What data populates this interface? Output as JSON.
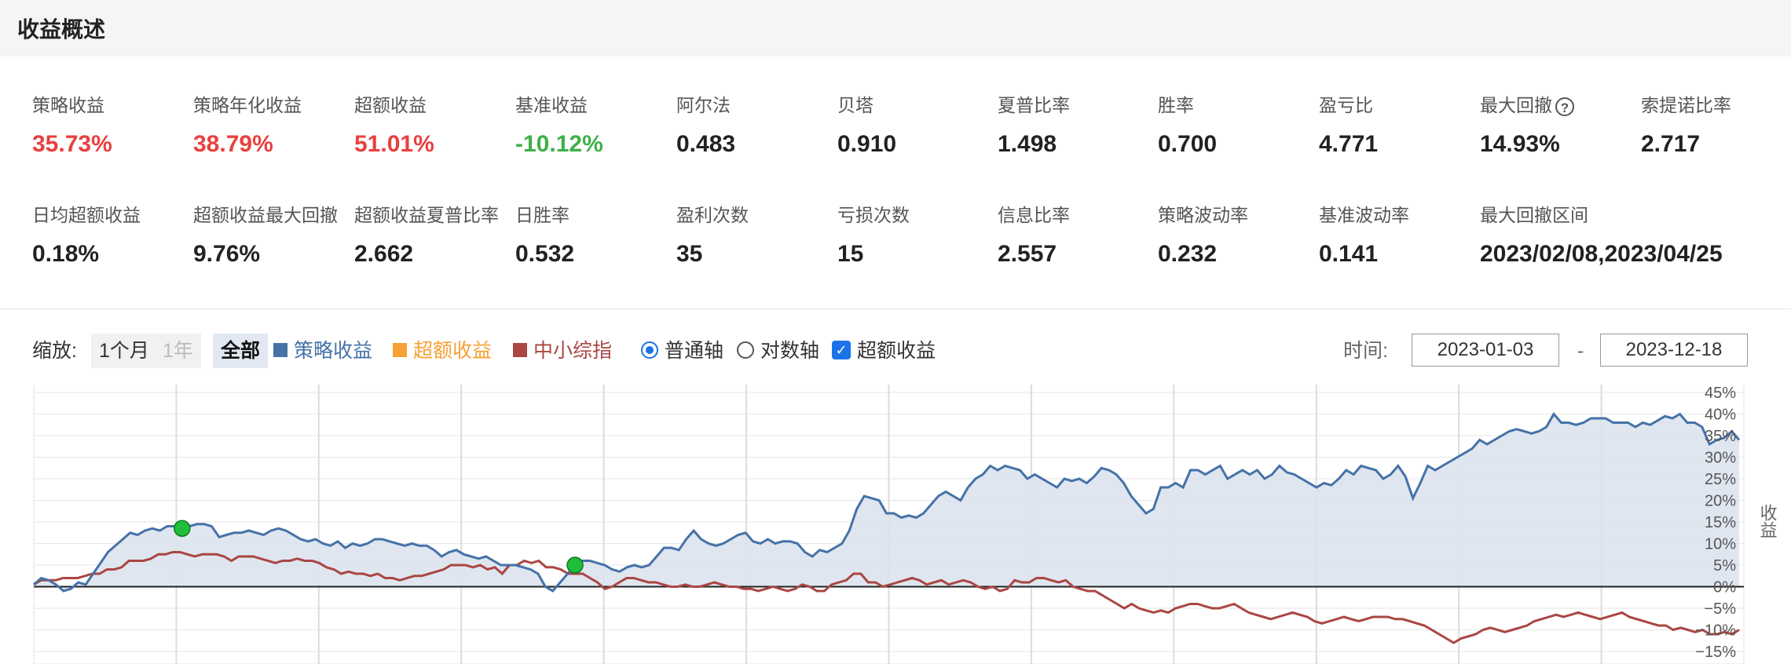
{
  "header": {
    "title": "收益概述"
  },
  "metrics_row1": [
    {
      "label": "策略收益",
      "value": "35.73%",
      "tone": "pos"
    },
    {
      "label": "策略年化收益",
      "value": "38.79%",
      "tone": "pos"
    },
    {
      "label": "超额收益",
      "value": "51.01%",
      "tone": "pos"
    },
    {
      "label": "基准收益",
      "value": "-10.12%",
      "tone": "neg"
    },
    {
      "label": "阿尔法",
      "value": "0.483",
      "tone": ""
    },
    {
      "label": "贝塔",
      "value": "0.910",
      "tone": ""
    },
    {
      "label": "夏普比率",
      "value": "1.498",
      "tone": ""
    },
    {
      "label": "胜率",
      "value": "0.700",
      "tone": ""
    },
    {
      "label": "盈亏比",
      "value": "4.771",
      "tone": ""
    },
    {
      "label": "最大回撤",
      "value": "14.93%",
      "tone": "",
      "help": "?"
    },
    {
      "label": "索提诺比率",
      "value": "2.717",
      "tone": ""
    }
  ],
  "metrics_row2": [
    {
      "label": "日均超额收益",
      "value": "0.18%"
    },
    {
      "label": "超额收益最大回撤",
      "value": "9.76%"
    },
    {
      "label": "超额收益夏普比率",
      "value": "2.662"
    },
    {
      "label": "日胜率",
      "value": "0.532"
    },
    {
      "label": "盈利次数",
      "value": "35"
    },
    {
      "label": "亏损次数",
      "value": "15"
    },
    {
      "label": "信息比率",
      "value": "2.557"
    },
    {
      "label": "策略波动率",
      "value": "0.232"
    },
    {
      "label": "基准波动率",
      "value": "0.141"
    },
    {
      "label": "最大回撤区间",
      "value": "2023/02/08,2023/04/25"
    }
  ],
  "toolbar": {
    "zoom_label": "缩放:",
    "zoom_1m": "1个月",
    "zoom_1y": "1年",
    "zoom_all": "全部",
    "legend": [
      {
        "name": "策略收益",
        "color": "#4572a7"
      },
      {
        "name": "超额收益",
        "color": "#f7a035"
      },
      {
        "name": "中小综指",
        "color": "#aa4643"
      }
    ],
    "radio_normal": "普通轴",
    "radio_log": "对数轴",
    "checkbox_excess": "超额收益",
    "time_label": "时间:",
    "date_from": "2023-01-03",
    "date_sep": "-",
    "date_to": "2023-12-18"
  },
  "chart_data": {
    "type": "line",
    "y_axis_label": "收益",
    "y_ticks": [
      "45%",
      "40%",
      "35%",
      "30%",
      "25%",
      "20%",
      "15%",
      "10%",
      "5%",
      "0%",
      "−5%",
      "−10%",
      "−15%"
    ],
    "ylim": [
      -15,
      45
    ],
    "x_range": [
      "2023-01-03",
      "2023-12-18"
    ],
    "series": [
      {
        "name": "策略收益",
        "color": "#4572a7",
        "values": [
          0.5,
          2,
          1.5,
          0.5,
          -1,
          -0.5,
          1,
          0.5,
          3,
          5.5,
          8,
          9.5,
          11,
          12.5,
          12,
          13,
          13.5,
          13,
          14,
          14,
          13.5,
          14,
          14.5,
          14.5,
          14,
          11.5,
          12,
          12.5,
          12.5,
          13,
          12.5,
          12,
          13,
          13.5,
          13,
          12,
          11,
          10.5,
          11,
          10,
          9.5,
          10.5,
          9,
          10,
          9.5,
          10,
          11,
          11,
          10.5,
          10,
          9.5,
          10,
          9.5,
          9.5,
          8.5,
          7,
          8,
          8.5,
          7.5,
          7,
          6.5,
          7,
          6,
          5,
          5,
          5,
          4.5,
          4,
          3,
          0,
          -1,
          1,
          3,
          5,
          6,
          6,
          5.5,
          5,
          4,
          3.5,
          4.5,
          5,
          4.5,
          5,
          7,
          9,
          9,
          8.5,
          11,
          13,
          11,
          10,
          9.5,
          10,
          11,
          12,
          12.5,
          10.5,
          10,
          11,
          10,
          10.5,
          10.5,
          10,
          8,
          7,
          8.5,
          8,
          9,
          10,
          13,
          18,
          21,
          20.5,
          20,
          17,
          17,
          16,
          16.5,
          16,
          17,
          19,
          21,
          22,
          21,
          20,
          23,
          25,
          26,
          28,
          27,
          28,
          27.5,
          27,
          25,
          26,
          25,
          24,
          23,
          25,
          24.5,
          25,
          24,
          25.5,
          27.5,
          27,
          26,
          24,
          21,
          19,
          17,
          18,
          23,
          23,
          24,
          23,
          27,
          27,
          26,
          27,
          28,
          25,
          26,
          27,
          26,
          27,
          25,
          26,
          28,
          26.5,
          26,
          25,
          24,
          23,
          24,
          23.5,
          25,
          27,
          26,
          28,
          27.5,
          27,
          25,
          26,
          28,
          25.5,
          20.5,
          24,
          28,
          27,
          28,
          29,
          30,
          31,
          32,
          34,
          33,
          34,
          35,
          36,
          36.5,
          36,
          35.5,
          36,
          37,
          40,
          38,
          38,
          37.5,
          38,
          39,
          39,
          39,
          38,
          38,
          38,
          37,
          38,
          37.5,
          38.5,
          39.5,
          39,
          40,
          38,
          38,
          37,
          33,
          34,
          34.5,
          36,
          34
        ]
      },
      {
        "name": "中小综指",
        "color": "#aa4643",
        "values": [
          0.5,
          1.5,
          1.5,
          1.5,
          2,
          2,
          2,
          2.5,
          3,
          3,
          4,
          4,
          4.5,
          6,
          6,
          6,
          6.5,
          7.5,
          7.5,
          8,
          8,
          7.5,
          7,
          7.5,
          7.5,
          7.5,
          7,
          6,
          7,
          7,
          7,
          6.5,
          6,
          5.5,
          6,
          6,
          6.5,
          6,
          6,
          5.5,
          4.5,
          4,
          3,
          3.5,
          3,
          3,
          2.5,
          3,
          2,
          2,
          1.5,
          2,
          2.5,
          2.5,
          3,
          3.5,
          4,
          5,
          5,
          5,
          4.5,
          5,
          4,
          4.5,
          3,
          5,
          5,
          6,
          5.5,
          6,
          4.5,
          4.5,
          4,
          3,
          3,
          3,
          2,
          1,
          -0.5,
          0,
          1,
          2,
          2,
          1.5,
          1,
          1,
          0.5,
          0,
          0,
          0.5,
          0,
          0,
          0.5,
          1,
          0.5,
          0,
          0,
          -0.5,
          -0.5,
          -1,
          -0.5,
          0,
          -0.5,
          -1,
          -0.5,
          0.5,
          0,
          -1,
          -1,
          0.5,
          1,
          1.5,
          3,
          3,
          1,
          1,
          0,
          0.5,
          1,
          1.5,
          2,
          1.5,
          0.5,
          1,
          1.5,
          0.5,
          1,
          1.5,
          1,
          0,
          -0.5,
          0,
          -1,
          -0.5,
          1.5,
          1,
          1,
          2,
          2,
          1.5,
          1,
          1.5,
          0,
          -0.5,
          -1,
          -1,
          -2,
          -3,
          -4,
          -5,
          -4,
          -5,
          -5.5,
          -6,
          -5.5,
          -6,
          -5,
          -4.5,
          -4,
          -4,
          -4.5,
          -5,
          -5,
          -4.5,
          -4,
          -5,
          -6,
          -6.5,
          -7,
          -7.5,
          -7,
          -6.5,
          -6,
          -6.5,
          -7,
          -8,
          -8.5,
          -8,
          -7.5,
          -7,
          -7.5,
          -8,
          -7.5,
          -7,
          -7,
          -7,
          -7.5,
          -7.5,
          -8,
          -8.5,
          -9,
          -10,
          -11,
          -12,
          -13,
          -12,
          -11.5,
          -11,
          -10,
          -9.5,
          -10,
          -10.5,
          -10,
          -9.5,
          -9,
          -8,
          -7.5,
          -7,
          -6.5,
          -7,
          -6.5,
          -6,
          -6.5,
          -7,
          -7.5,
          -7,
          -6.5,
          -6,
          -7,
          -7.5,
          -8,
          -8.5,
          -9,
          -9,
          -10,
          -9.5,
          -10,
          -10.5,
          -10,
          -11,
          -11,
          -10.5,
          -11,
          -10
        ]
      }
    ],
    "markers": [
      {
        "series": "策略收益",
        "index": 20,
        "type": "high"
      },
      {
        "series": "策略收益",
        "index": 73,
        "type": "low"
      }
    ]
  }
}
